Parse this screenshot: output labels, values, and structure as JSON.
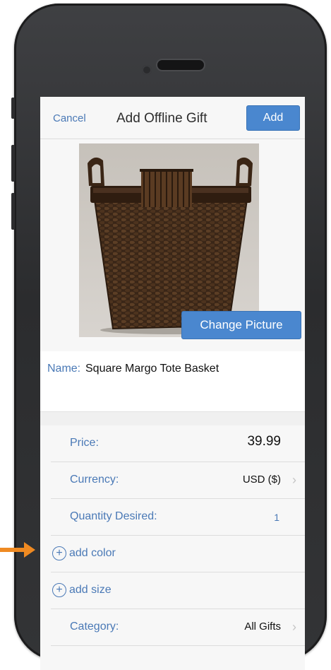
{
  "header": {
    "cancel_label": "Cancel",
    "title": "Add Offline Gift",
    "add_label": "Add"
  },
  "photo": {
    "change_picture_label": "Change Picture"
  },
  "name": {
    "label": "Name:",
    "value": "Square Margo Tote Basket"
  },
  "fields": {
    "price": {
      "label": "Price:",
      "value": "39.99"
    },
    "currency": {
      "label": "Currency:",
      "value": "USD ($)"
    },
    "quantity": {
      "label": "Quantity Desired:",
      "value": "1"
    },
    "add_color_label": "add color",
    "add_size_label": "add size",
    "category": {
      "label": "Category:",
      "value": "All Gifts"
    }
  },
  "colors": {
    "accent": "#4a87cf",
    "link": "#4a79b6",
    "annotation_arrow": "#ef8a22"
  },
  "icons": [
    "chevron-right-icon",
    "plus-circle-icon",
    "arrow-right-icon"
  ]
}
